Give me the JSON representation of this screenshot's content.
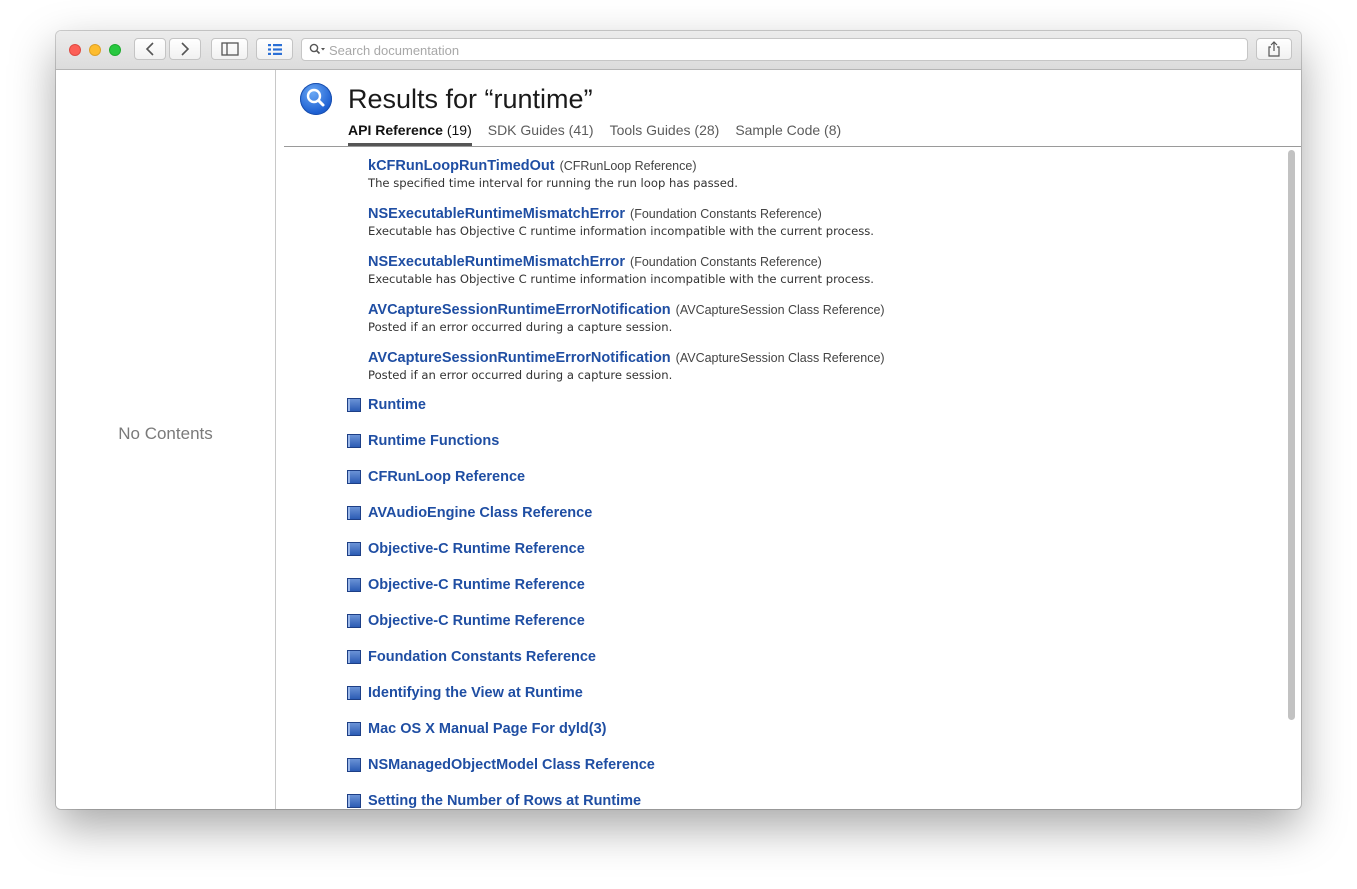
{
  "search": {
    "placeholder": "Search documentation"
  },
  "sidebar": {
    "empty_text": "No Contents"
  },
  "header": {
    "title": "Results for “runtime”"
  },
  "tabs": [
    {
      "label": "API Reference",
      "count": "(19)",
      "active": true
    },
    {
      "label": "SDK Guides",
      "count": "(41)",
      "active": false
    },
    {
      "label": "Tools Guides",
      "count": "(28)",
      "active": false
    },
    {
      "label": "Sample Code",
      "count": "(8)",
      "active": false
    }
  ],
  "api_results": [
    {
      "name": "kCFRunLoopRunTimedOut",
      "ref": "(CFRunLoop Reference)",
      "desc": "The specified time interval for running the run loop has passed."
    },
    {
      "name": "NSExecutableRuntimeMismatchError",
      "ref": "(Foundation Constants Reference)",
      "desc": "Executable has Objective C runtime information incompatible with the current process."
    },
    {
      "name": "NSExecutableRuntimeMismatchError",
      "ref": "(Foundation Constants Reference)",
      "desc": "Executable has Objective C runtime information incompatible with the current process."
    },
    {
      "name": "AVCaptureSessionRuntimeErrorNotification",
      "ref": "(AVCaptureSession Class Reference)",
      "desc": "Posted if an error occurred during a capture session."
    },
    {
      "name": "AVCaptureSessionRuntimeErrorNotification",
      "ref": "(AVCaptureSession Class Reference)",
      "desc": "Posted if an error occurred during a capture session."
    }
  ],
  "doc_results": [
    "Runtime",
    "Runtime Functions",
    "CFRunLoop Reference",
    "AVAudioEngine Class Reference",
    "Objective-C Runtime Reference",
    "Objective-C Runtime Reference",
    "Objective-C Runtime Reference",
    "Foundation Constants Reference",
    "Identifying the View at Runtime",
    "Mac OS X Manual Page For dyld(3)",
    "NSManagedObjectModel Class Reference",
    "Setting the Number of Rows at Runtime"
  ]
}
